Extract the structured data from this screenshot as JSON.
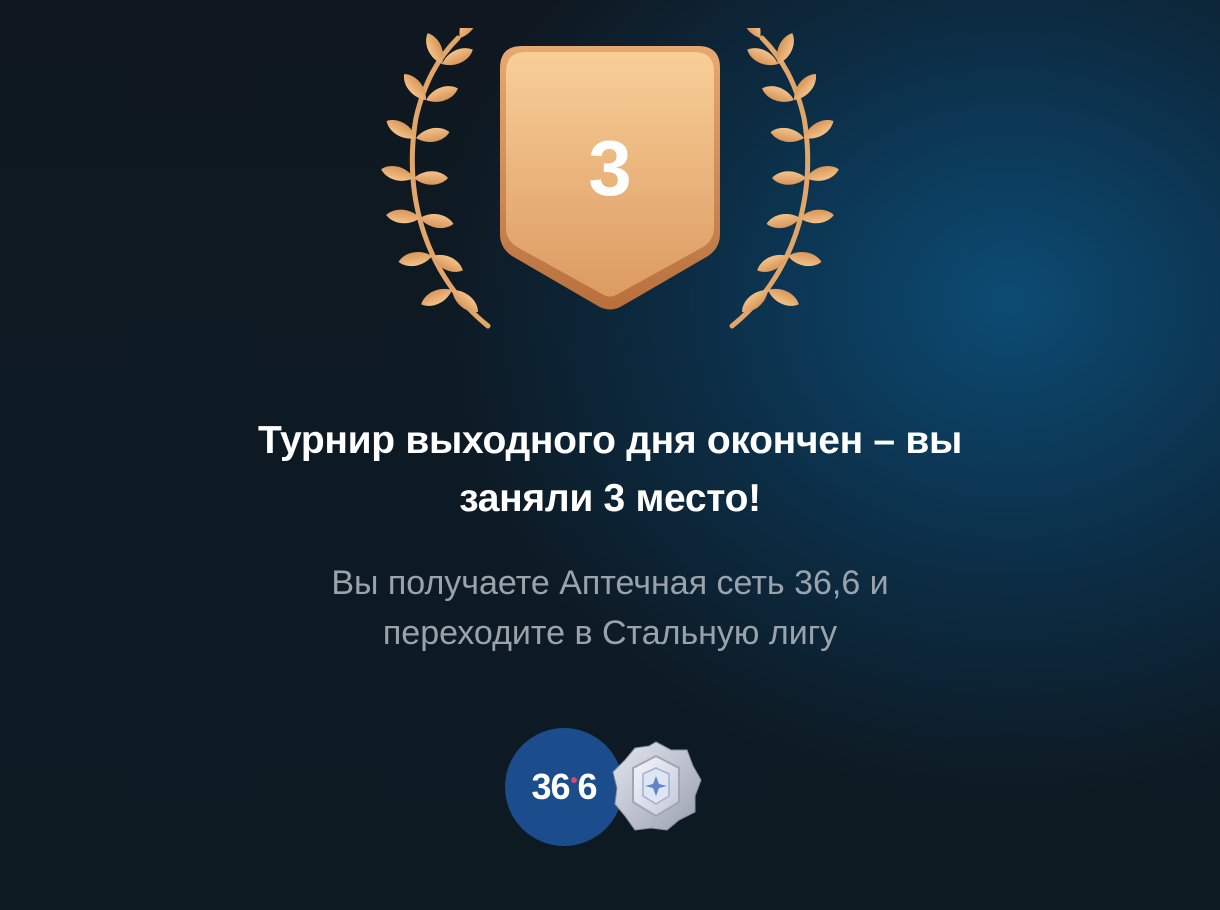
{
  "award": {
    "place_number": "3",
    "icon": "laurel-wreath-icon",
    "badge_color_top": "#f7c58c",
    "badge_color_bottom": "#d9925a"
  },
  "headline": {
    "line1": "Турнир выходного дня окончен – вы",
    "line2": "заняли 3 место!"
  },
  "subtext": {
    "line1": "Вы получаете Аптечная сеть 36,6 и",
    "line2": "переходите в Стальную лигу"
  },
  "rewards": {
    "partner_logo": {
      "icon": "pharmacy-36-6-logo",
      "text_left": "36",
      "text_dot": "•",
      "text_right": "6",
      "color": "#1b4c8c"
    },
    "league_badge": {
      "icon": "steel-league-badge-icon"
    }
  },
  "colors": {
    "background_dark": "#0f1820",
    "background_glow": "#0c4e78",
    "headline": "#ffffff",
    "subtext": "#9aa3ab"
  }
}
